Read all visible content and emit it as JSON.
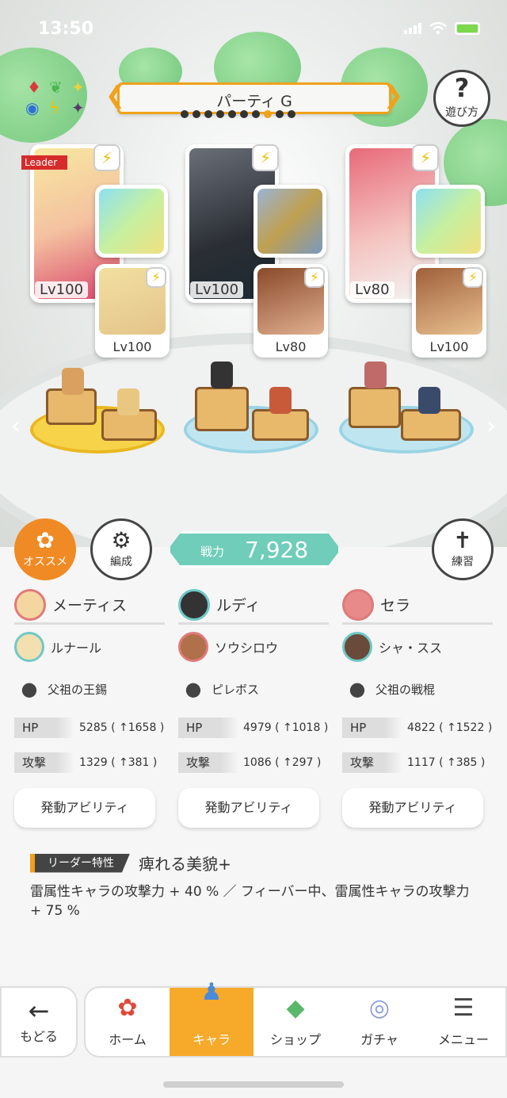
{
  "status": {
    "time": "13:50"
  },
  "header": {
    "party_title": "パーティ G",
    "help_label": "遊び方",
    "party_dots": 10,
    "active_dot": 7,
    "leader_tag": "Leader"
  },
  "party": [
    {
      "name": "メーティス",
      "level": "Lv100",
      "sub_name": "ルナール",
      "sub_level": "Lv100",
      "weapon": "父祖の王錫",
      "hp": "5285",
      "hp_bonus": "( ↑1658 )",
      "atk": "1329",
      "atk_bonus": "( ↑381 )"
    },
    {
      "name": "ルディ",
      "level": "Lv100",
      "sub_name": "ソウシロウ",
      "sub_level": "Lv80",
      "weapon": "ピレボス",
      "hp": "4979",
      "hp_bonus": "( ↑1018 )",
      "atk": "1086",
      "atk_bonus": "( ↑297 )"
    },
    {
      "name": "セラ",
      "level": "Lv80",
      "sub_name": "シャ・スス",
      "sub_level": "Lv100",
      "weapon": "父祖の戦棍",
      "hp": "4822",
      "hp_bonus": "( ↑1522 )",
      "atk": "1117",
      "atk_bonus": "( ↑385 )"
    }
  ],
  "controls": {
    "recommend_label": "オススメ",
    "formation_label": "編成",
    "practice_label": "練習",
    "power_key": "戦力",
    "power_value": "7,928"
  },
  "stat_labels": {
    "hp": "HP",
    "atk": "攻撃"
  },
  "ability_label": "発動アビリティ",
  "leader_trait": {
    "tag": "リーダー特性",
    "title": "痺れる美貌+",
    "description": "雷属性キャラの攻撃力 + 40 % ／ フィーバー中、雷属性キャラの攻撃力 + 75 %"
  },
  "nav": {
    "back": "もどる",
    "tabs": [
      "ホーム",
      "キャラ",
      "ショップ",
      "ガチャ",
      "メニュー"
    ],
    "active_tab": "キャラ"
  },
  "colors": {
    "accent": "#f0a21b",
    "power": "#6fcdb9",
    "active_tab": "#f7a92a",
    "leader": "#d62b2b"
  }
}
